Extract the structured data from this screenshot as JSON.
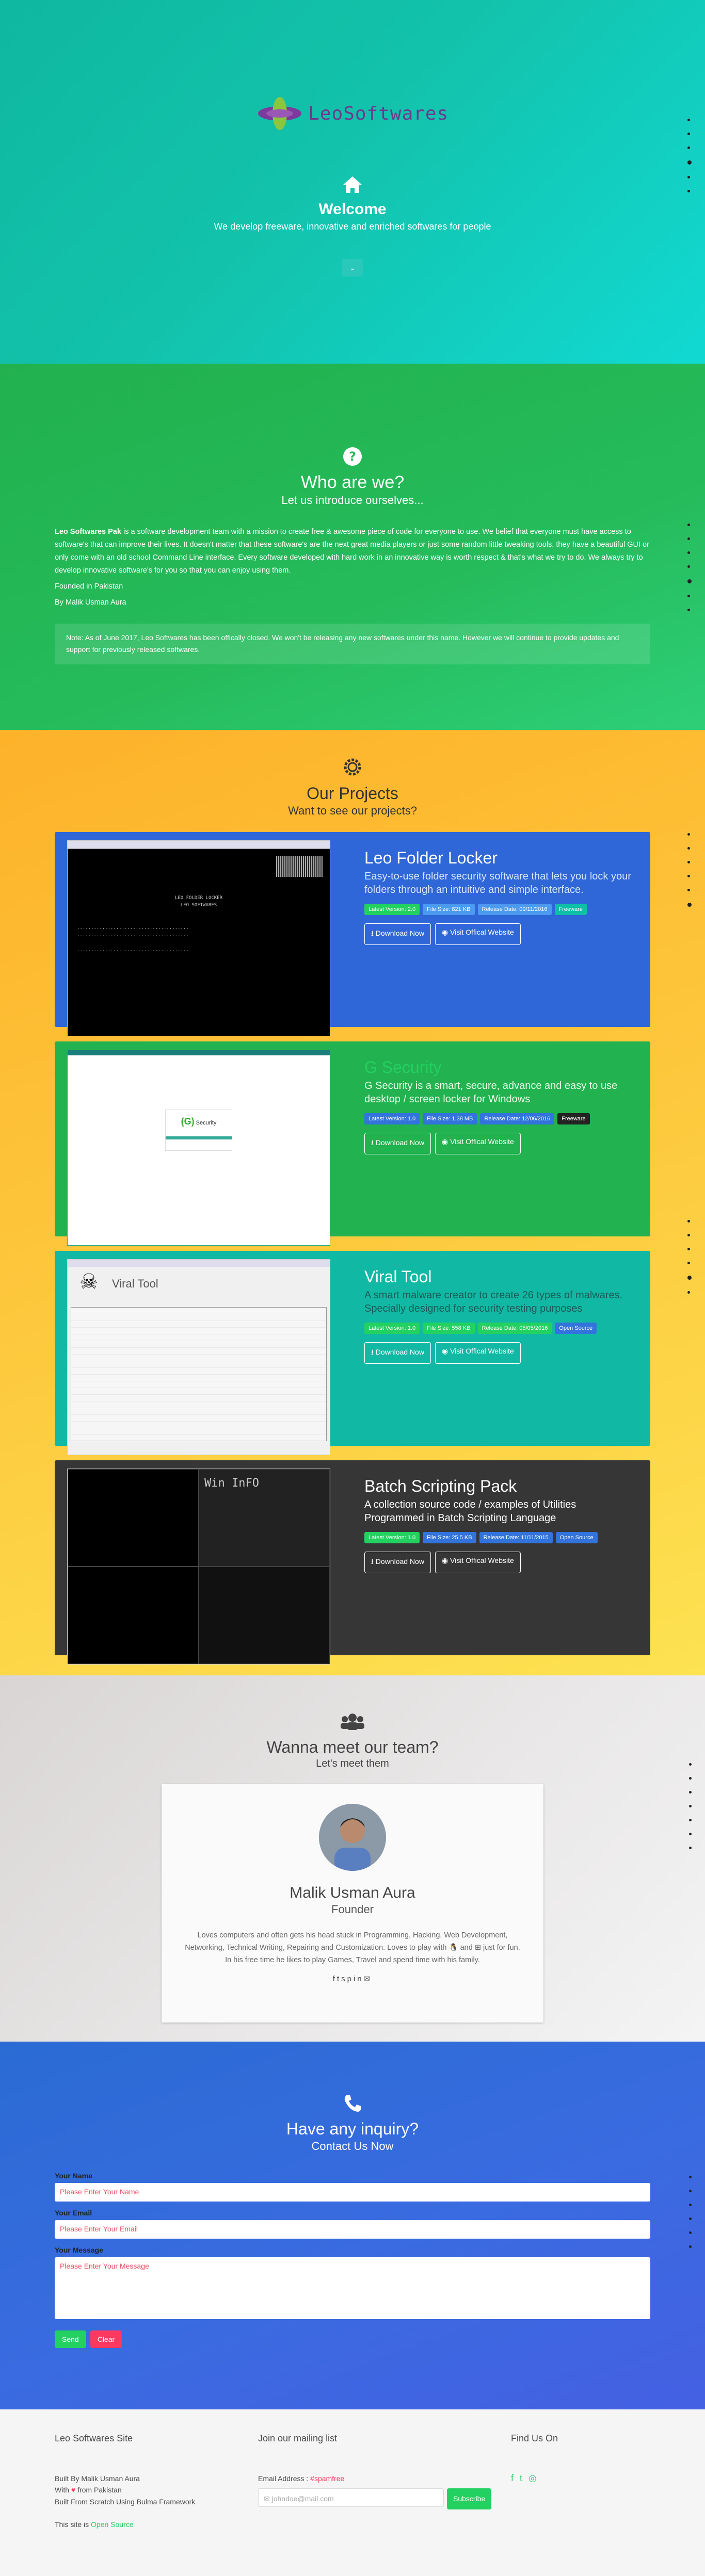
{
  "hero": {
    "logo_text": "LeoSoftwares",
    "title": "Welcome",
    "subtitle": "We develop freeware, innovative and enriched softwares for people",
    "button_icon": "chevron-down-icon"
  },
  "about": {
    "title": "Who are we?",
    "subtitle": "Let us introduce ourselves...",
    "company": "Leo Softwares Pak",
    "paragraph": " is a software development team with a mission to create free & awesome piece of code for everyone to use. We belief that everyone must have access to software's that can improve their lives. It doesn't matter that these software's are the next great media players or just some random little tweaking tools, they have a beautiful GUI or only come with an old school Command Line interface. Every software developed with hard work in an innovative way is worth respect & that's what we try to do. We always try to develop innovative software's for you so that you can enjoy using them.",
    "founded": "Founded in Pakistan",
    "by": "By Malik Usman Aura",
    "note": "Note: As of June 2017, Leo Softwares has been offically closed. We won't be releasing any new softwares under this name. However we will continue to provide updates and support for previously released softwares."
  },
  "projects": {
    "title": "Our Projects",
    "subtitle": "Want to see our projects?",
    "items": [
      {
        "name": "Leo Folder Locker",
        "desc": "Easy-to-use folder security software that lets you lock your folders through an intuitive and simple interface.",
        "tags": [
          "Latest Version: 2.0",
          "File Size: 821 KB",
          "Release Date: 09/11/2016",
          "Freeware"
        ],
        "download": "Download Now",
        "website": "Visit Offical Website"
      },
      {
        "name": "G Security",
        "desc": "G Security is a smart, secure, advance and easy to use desktop / screen locker for Windows",
        "tags": [
          "Latest Version: 1.0",
          "File Size: 1.38 MB",
          "Release Date: 12/06/2016",
          "Freeware"
        ],
        "download": "Download Now",
        "website": "Visit Offical Website"
      },
      {
        "name": "Viral Tool",
        "desc": "A smart malware creator to create 26 types of malwares. Specially designed for security testing purposes",
        "tags": [
          "Latest Version: 1.0",
          "File Size: 558 KB",
          "Release Date: 05/05/2016",
          "Open Source"
        ],
        "download": "Download Now",
        "website": "Visit Offical Website"
      },
      {
        "name": "Batch Scripting Pack",
        "desc": "A collection source code / examples of Utilities Programmed in Batch Scripting Language",
        "tags": [
          "Latest Version: 1.0",
          "File Size: 25.5 KB",
          "Release Date: 11/11/2015",
          "Open Source"
        ],
        "download": "Download Now",
        "website": "Visit Offical Website"
      }
    ]
  },
  "team": {
    "title": "Wanna meet our team?",
    "subtitle": "Let's meet them",
    "name": "Malik Usman Aura",
    "role": "Founder",
    "bio_1": "Loves computers and often gets his head stuck in Programming, Hacking, Web Development, Networking, Technical Writing, Repairing and Customization. Loves to play with",
    "bio_2": "and",
    "bio_3": "just for fun. In his free time he likes to play Games, Travel and spend time with his family.",
    "social_icons": [
      "facebook-icon",
      "twitter-icon",
      "skype-icon",
      "pinterest-icon",
      "linkedin-icon",
      "envelope-icon"
    ]
  },
  "contact": {
    "title": "Have any inquiry?",
    "subtitle": "Contact Us Now",
    "name_label": "Your Name",
    "name_placeholder": "Please Enter Your Name",
    "email_label": "Your Email",
    "email_placeholder": "Please Enter Your Email",
    "message_label": "Your Message",
    "message_placeholder": "Please Enter Your Message",
    "send": "Send",
    "clear": "Clear"
  },
  "footer": {
    "col1_title": "Leo Softwares Site",
    "built_by": "Built By Malik Usman Aura",
    "with": "With",
    "from": "from Pakistan",
    "built_from": "Built From Scratch Using Bulma Framework",
    "open_source_prefix": "This site is ",
    "open_source": "Open Source",
    "col2_title": "Join our mailing list",
    "email_label": "Email Address : ",
    "email_note": "#spamfree",
    "email_placeholder": "johndoe@mail.com",
    "subscribe": "Subscribe",
    "col3_title": "Find Us On"
  },
  "colors": {
    "hero": "#13c2ab",
    "about": "#25bb5b",
    "projects": "#fdc83d",
    "contact": "#3a6be0",
    "accent_green": "#23d160",
    "accent_red": "#ff3860"
  }
}
